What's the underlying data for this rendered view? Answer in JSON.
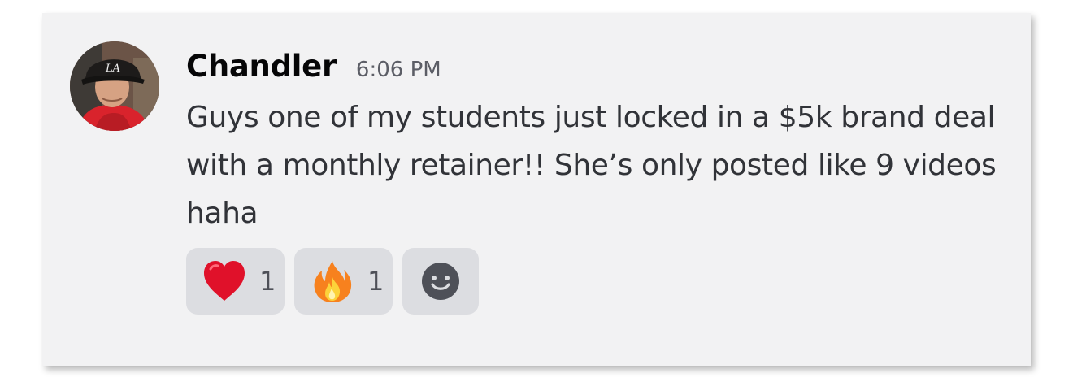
{
  "message": {
    "author": "Chandler",
    "timestamp": "6:06 PM",
    "text": "Guys one of my students just locked in a $5k brand deal with a monthly retainer!! She’s only posted like 9 videos haha",
    "reactions": [
      {
        "emoji": "red-heart",
        "count": "1"
      },
      {
        "emoji": "fire",
        "count": "1"
      }
    ],
    "add_reaction_icon": "smiley-add-icon"
  },
  "colors": {
    "card_background": "#f2f2f3",
    "reaction_background": "#dcdde1",
    "author_color": "#060607",
    "text_color": "#313338",
    "timestamp_color": "#5c5e66"
  }
}
